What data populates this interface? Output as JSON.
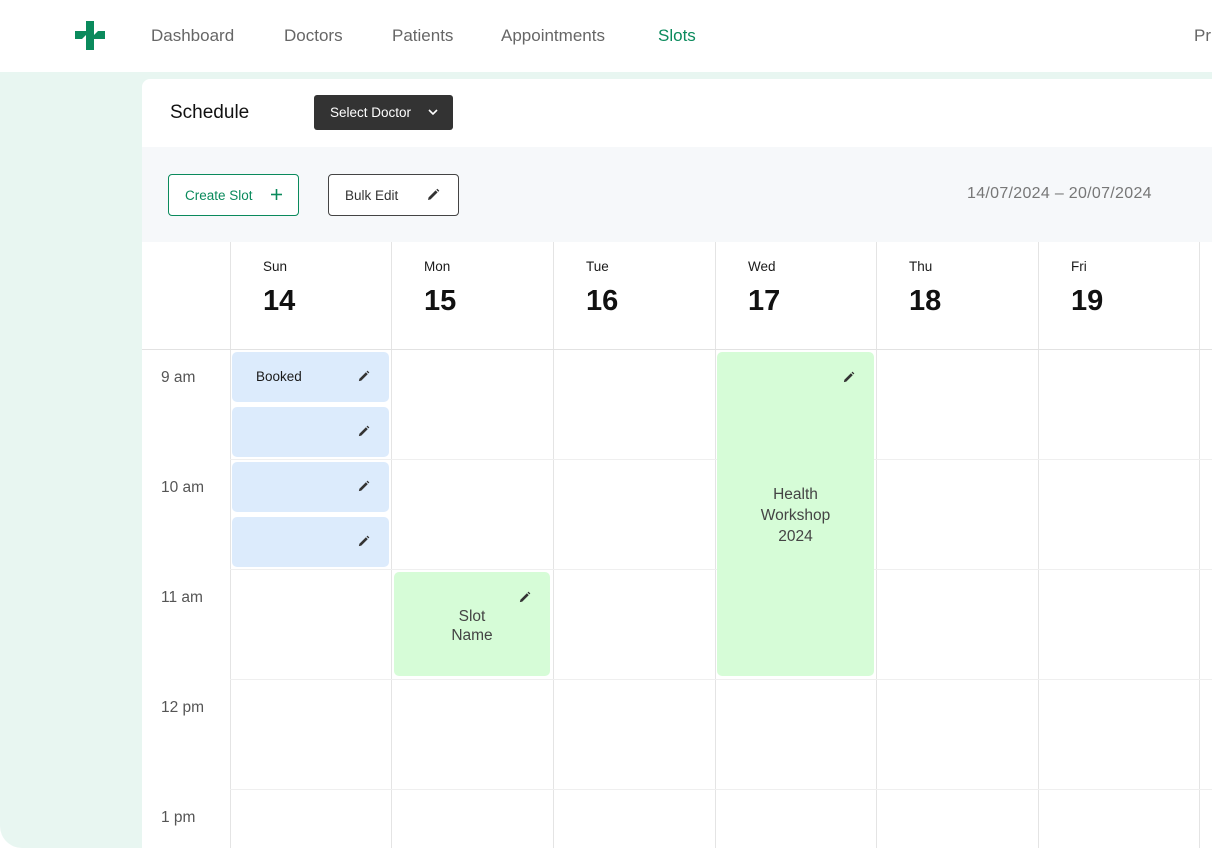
{
  "nav": {
    "items": [
      {
        "label": "Dashboard"
      },
      {
        "label": "Doctors"
      },
      {
        "label": "Patients"
      },
      {
        "label": "Appointments"
      },
      {
        "label": "Slots",
        "active": true
      }
    ],
    "profile_label": "Pr"
  },
  "schedule": {
    "title": "Schedule",
    "select_doctor_label": "Select Doctor"
  },
  "toolbar": {
    "create_slot_label": "Create Slot",
    "bulk_edit_label": "Bulk Edit",
    "date_range": "14/07/2024  –  20/07/2024"
  },
  "days": [
    {
      "name": "Sun",
      "num": "14"
    },
    {
      "name": "Mon",
      "num": "15"
    },
    {
      "name": "Tue",
      "num": "16"
    },
    {
      "name": "Wed",
      "num": "17"
    },
    {
      "name": "Thu",
      "num": "18"
    },
    {
      "name": "Fri",
      "num": "19"
    }
  ],
  "times": [
    "9 am",
    "10 am",
    "11 am",
    "12 pm",
    "1 pm"
  ],
  "slots": {
    "sun_booked_label": "Booked",
    "mon_slot_line1": "Slot",
    "mon_slot_line2": "Name",
    "wed_line1": "Health",
    "wed_line2": "Workshop",
    "wed_line3": "2024"
  },
  "colors": {
    "brand": "#0a8a5c",
    "booked_slot": "#dcebfc",
    "event_slot": "#d6fcd7",
    "panel_bg": "#e8f6f1"
  },
  "icons": {
    "logo": "medical-cross-icon",
    "dropdown": "chevron-down-icon",
    "add": "plus-icon",
    "edit": "pencil-icon"
  }
}
